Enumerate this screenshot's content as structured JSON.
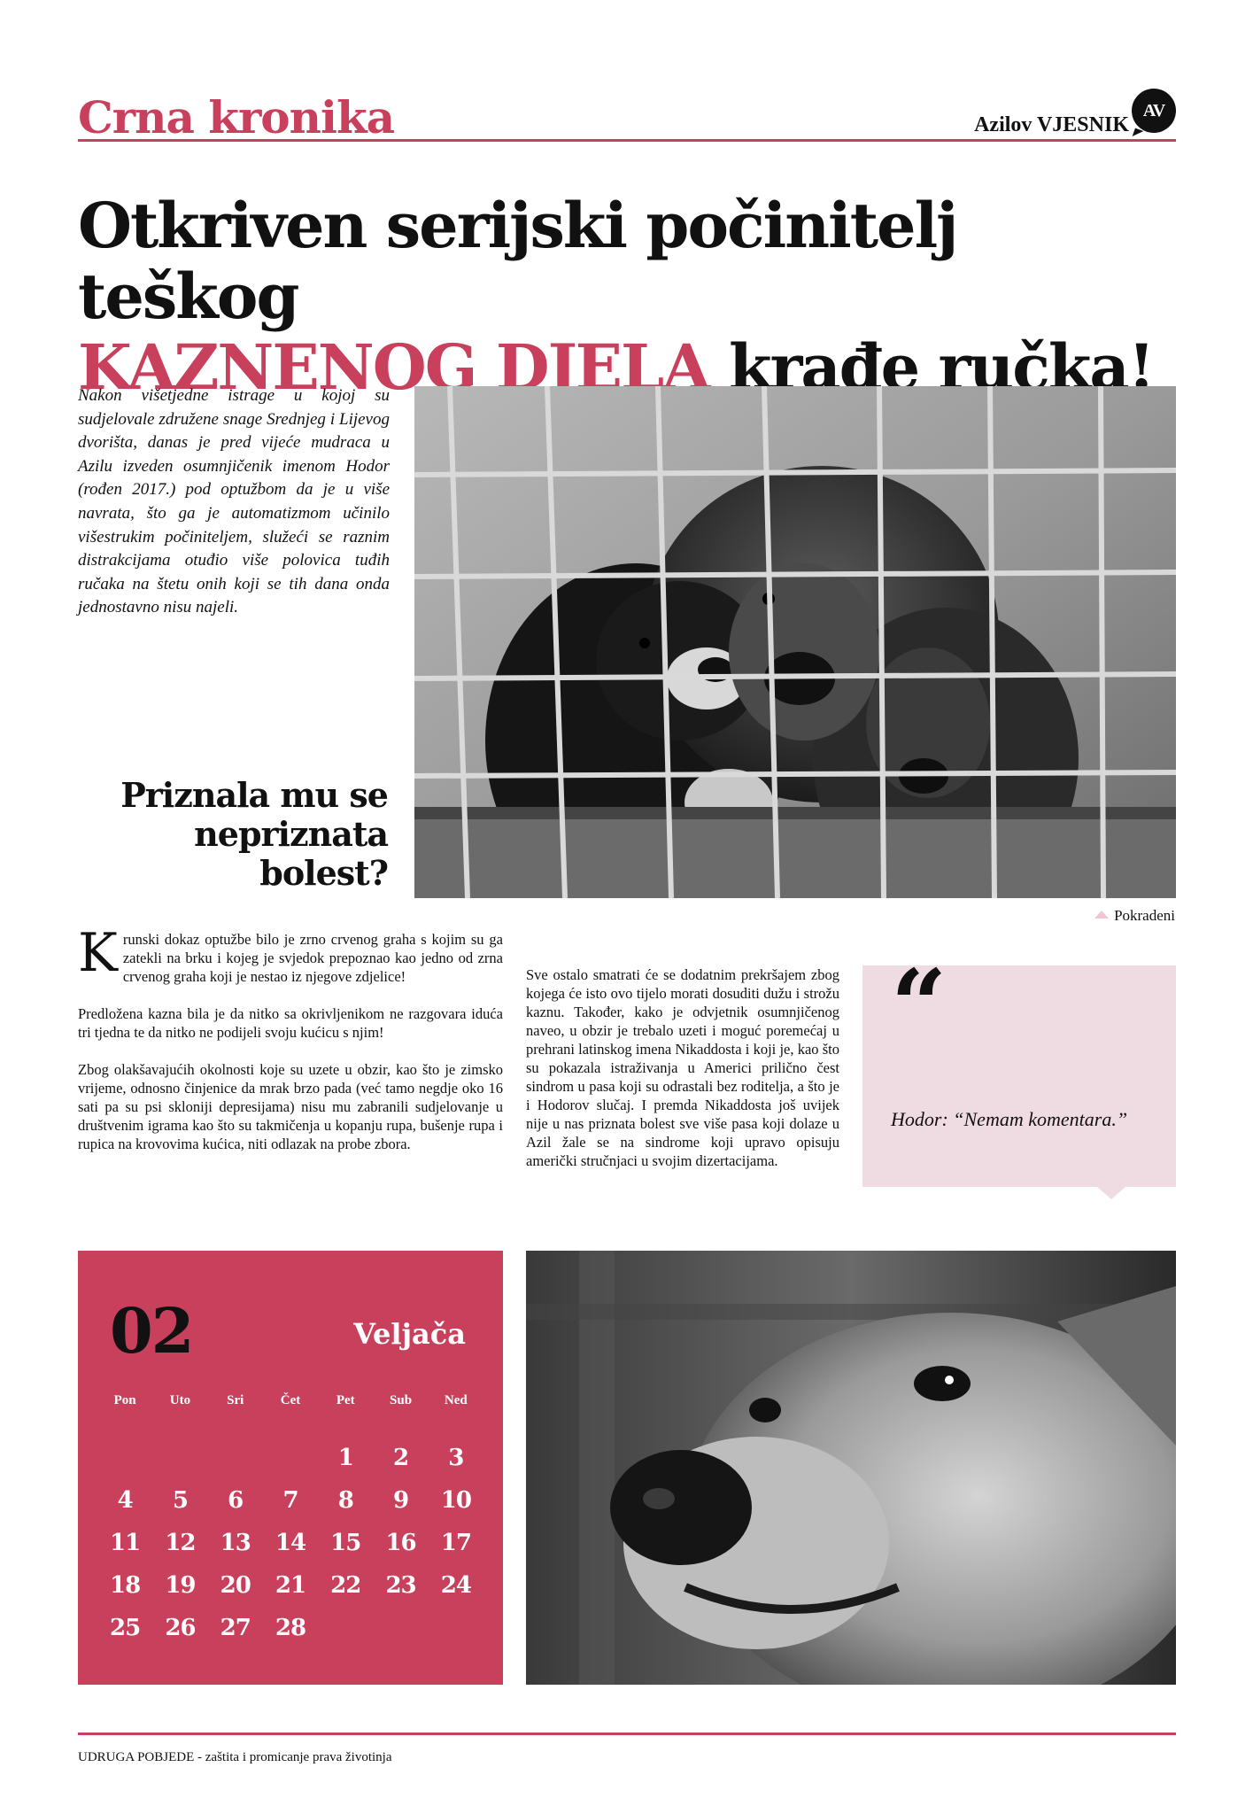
{
  "header": {
    "section": "Crna kronika",
    "brand": "Azilov VJESNIK",
    "logo": "AV"
  },
  "headline": {
    "line1": "Otkriven serijski počinitelj teškog",
    "accent": "KAZNENOG DJELA",
    "rest": " krađe ručka!"
  },
  "lead": "Nakon višetjedne istrage u kojoj su sudjelovale združene snage Srednjeg i Lijevog dvorišta, danas je pred vijeće mudraca u Azilu izveden osumnjičenik imenom Hodor (rođen 2017.) pod optužbom da je u više navrata, što ga je automatizmom učinilo višestrukim počiniteljem, služeći se raznim distrakcijama otuđio više polovica tuđih ručaka na štetu onih koji se tih dana onda jednostavno nisu najeli.",
  "subhead": "Priznala mu se nepriznata bolest?",
  "photo_caption": "Pokradeni",
  "body": {
    "dropcap": "K",
    "p1": "runski dokaz optužbe bilo je zrno crvenog graha s kojim su ga zatekli na brku i kojeg je svjedok prepoznao kao jedno od zrna crvenog graha koji je nestao iz njegove zdjelice!",
    "p2": "Predložena kazna bila je da nitko sa okrivljenikom ne razgovara iduća tri tjedna te da nitko ne podijeli svoju kućicu s njim!",
    "p3": "Zbog olakšavajućih okolnosti koje su uzete u obzir, kao što je zimsko vrijeme, odnosno činjenice da mrak brzo pada (već tamo negdje oko 16 sati pa su psi skloniji depresijama) nisu mu zabranili sudjelovanje u društvenim igrama kao što su takmičenja u kopanju rupa, bušenje rupa i rupica na krovovima kućica,  niti odlazak na probe zbora.",
    "p4": "Sve ostalo smatrati će se dodatnim prekršajem zbog kojega će isto ovo tijelo morati dosuditi dužu i strožu kaznu. Također, kako je odvjetnik osumnjičenog naveo, u obzir je trebalo uzeti i moguć poremećaj u prehrani latinskog imena Nikaddosta i koji je, kao što su pokazala istraživanja u Americi prilično čest sindrom u pasa koji su odrastali bez roditelja, a što je i Hodorov slučaj. I premda Nikaddosta još uvijek nije u nas priznata bolest sve više pasa koji dolaze u Azil žale se na sindrome koji upravo opisuju američki stručnjaci u svojim dizertacijama."
  },
  "quote": {
    "mark": "“",
    "text": "Hodor: “Nemam komentara.”"
  },
  "calendar": {
    "number": "02",
    "month": "Veljača",
    "weekdays": [
      "Pon",
      "Uto",
      "Sri",
      "Čet",
      "Pet",
      "Sub",
      "Ned"
    ],
    "weeks": [
      [
        "",
        "",
        "",
        "",
        "1",
        "2",
        "3"
      ],
      [
        "4",
        "5",
        "6",
        "7",
        "8",
        "9",
        "10"
      ],
      [
        "11",
        "12",
        "13",
        "14",
        "15",
        "16",
        "17"
      ],
      [
        "18",
        "19",
        "20",
        "21",
        "22",
        "23",
        "24"
      ],
      [
        "25",
        "26",
        "27",
        "28",
        "",
        "",
        ""
      ]
    ]
  },
  "footer": "UDRUGA POBJEDE - zaštita i promicanje prava životinja",
  "colors": {
    "accent": "#c8405c",
    "quote_bg": "#efdce2"
  }
}
